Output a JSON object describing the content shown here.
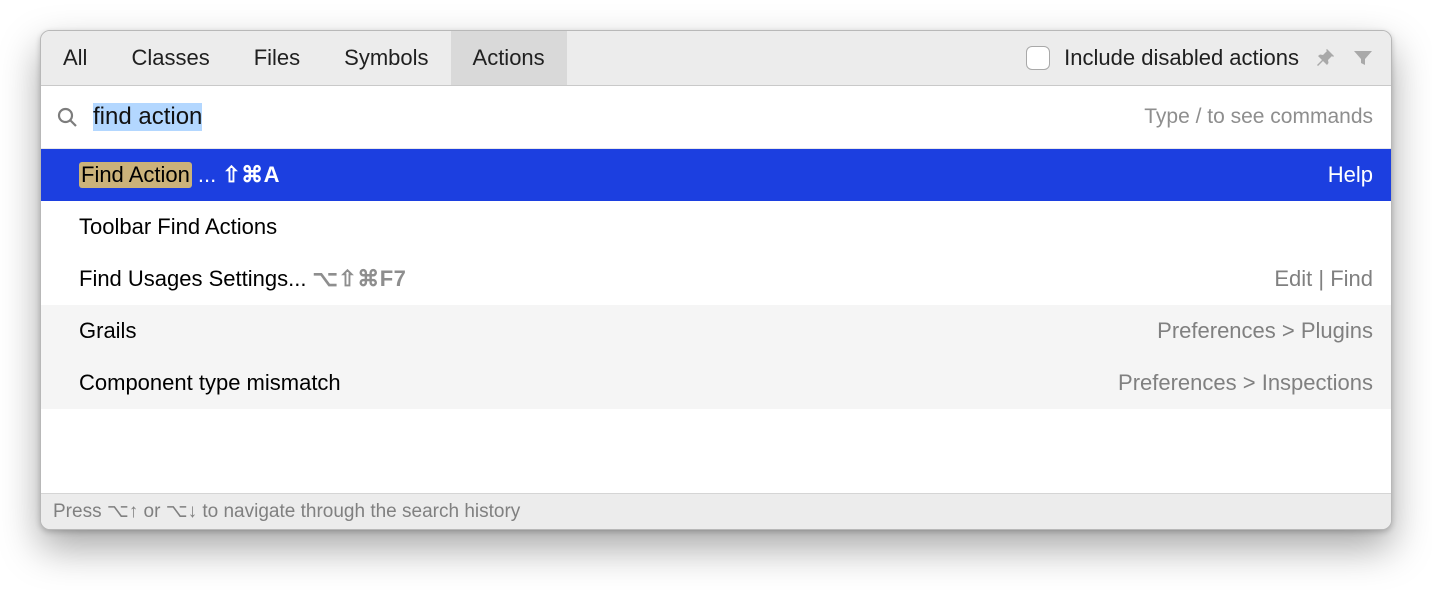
{
  "tabs": {
    "all": "All",
    "classes": "Classes",
    "files": "Files",
    "symbols": "Symbols",
    "actions": "Actions"
  },
  "toolbar": {
    "include_disabled_label": "Include disabled actions"
  },
  "search": {
    "value": "find action",
    "hint": "Type / to see commands"
  },
  "results": {
    "r0": {
      "highlight": "Find Action",
      "suffix": "...",
      "shortcut": "⇧⌘A",
      "hint": "Help"
    },
    "r1": {
      "label": "Toolbar Find Actions"
    },
    "r2": {
      "label": "Find Usages Settings...",
      "shortcut": "⌥⇧⌘F7",
      "hint": "Edit | Find"
    },
    "r3": {
      "label": "Grails",
      "hint": "Preferences > Plugins"
    },
    "r4": {
      "label": "Component type mismatch",
      "hint": "Preferences > Inspections"
    }
  },
  "footer": {
    "text": "Press ⌥↑ or ⌥↓ to navigate through the search history"
  }
}
